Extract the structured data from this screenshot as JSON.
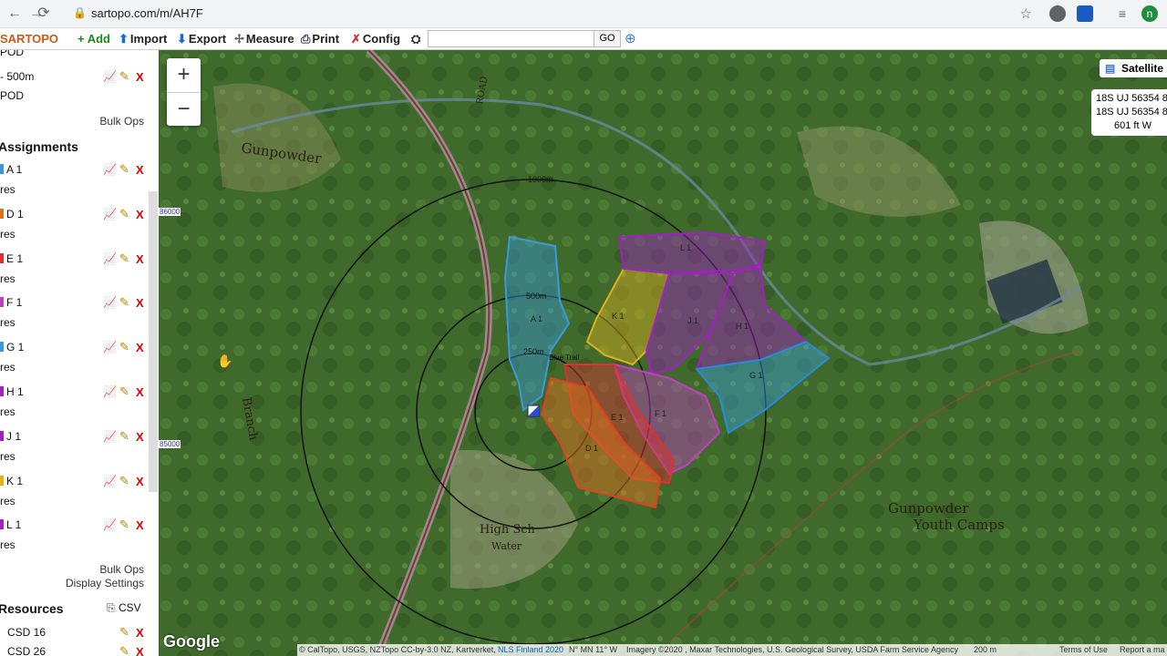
{
  "browser": {
    "url": "sartopo.com/m/AH7F",
    "profile_initial": "n"
  },
  "toolbar": {
    "logo": "SARTOPO",
    "add": "+ Add",
    "import": "Import",
    "export": "Export",
    "measure": "Measure",
    "print": "Print",
    "config": "Config",
    "search_value": "",
    "go": "GO"
  },
  "sidebar": {
    "top_items": [
      "POD",
      "- 500m",
      "POD"
    ],
    "bulk_ops_1": "Bulk Ops",
    "assignments_header": "Assignments",
    "assignments": [
      {
        "label": "A 1",
        "sub": "res",
        "color": "#3a9ad9"
      },
      {
        "label": "D 1",
        "sub": "res",
        "color": "#e07020"
      },
      {
        "label": "E 1",
        "sub": "res",
        "color": "#e03030"
      },
      {
        "label": "F 1",
        "sub": "res",
        "color": "#c040c0"
      },
      {
        "label": "G 1",
        "sub": "res",
        "color": "#3a9ad9"
      },
      {
        "label": "H 1",
        "sub": "res",
        "color": "#a020c0"
      },
      {
        "label": "J 1",
        "sub": "res",
        "color": "#a020c0"
      },
      {
        "label": "K 1",
        "sub": "res",
        "color": "#e0b020"
      },
      {
        "label": "L 1",
        "sub": "res",
        "color": "#a020c0"
      }
    ],
    "bulk_ops_2": "Bulk Ops",
    "display_settings": "Display Settings",
    "resources_header": "Resources",
    "csv": "CSV",
    "resources": [
      "CSD 16",
      "CSD 26"
    ]
  },
  "map": {
    "layer": "Satellite",
    "coords": [
      "18S UJ 56354 8",
      "18S UJ 56354 8",
      "601 ft    W"
    ],
    "grid_labels": [
      "86000",
      "85000"
    ],
    "ring_labels": [
      "1000m",
      "500m",
      "250m"
    ],
    "trail_label": "Blue Trail",
    "place_labels": {
      "river": "Gunpowder",
      "camps_1": "Gunpowder",
      "camps_2": "Youth Camps",
      "town": "High Sch",
      "water": "Water",
      "branch": "Branch",
      "road": "ROAD"
    },
    "polygons": [
      {
        "label": "A 1",
        "color": "#3a9ad9"
      },
      {
        "label": "K 1",
        "color": "#e0b020"
      },
      {
        "label": "L 1",
        "color": "#a020c0"
      },
      {
        "label": "J 1",
        "color": "#a020c0"
      },
      {
        "label": "H 1",
        "color": "#a020c0"
      },
      {
        "label": "G 1",
        "color": "#3a9ad9"
      },
      {
        "label": "F 1",
        "color": "#c040c0"
      },
      {
        "label": "E 1",
        "color": "#e03030"
      },
      {
        "label": "D 1",
        "color": "#e07020"
      }
    ],
    "google": "Google",
    "attribution": {
      "credits": "© CalTopo, USGS, NZTopo CC-by-3.0 NZ, Kartverket,",
      "nls": "NLS Finland 2020",
      "grid": "N° MN 11° W",
      "imagery": "Imagery ©2020 , Maxar Technologies, U.S. Geological Survey, USDA Farm Service Agency",
      "scale": "200 m",
      "terms": "Terms of Use",
      "report": "Report a ma"
    }
  }
}
